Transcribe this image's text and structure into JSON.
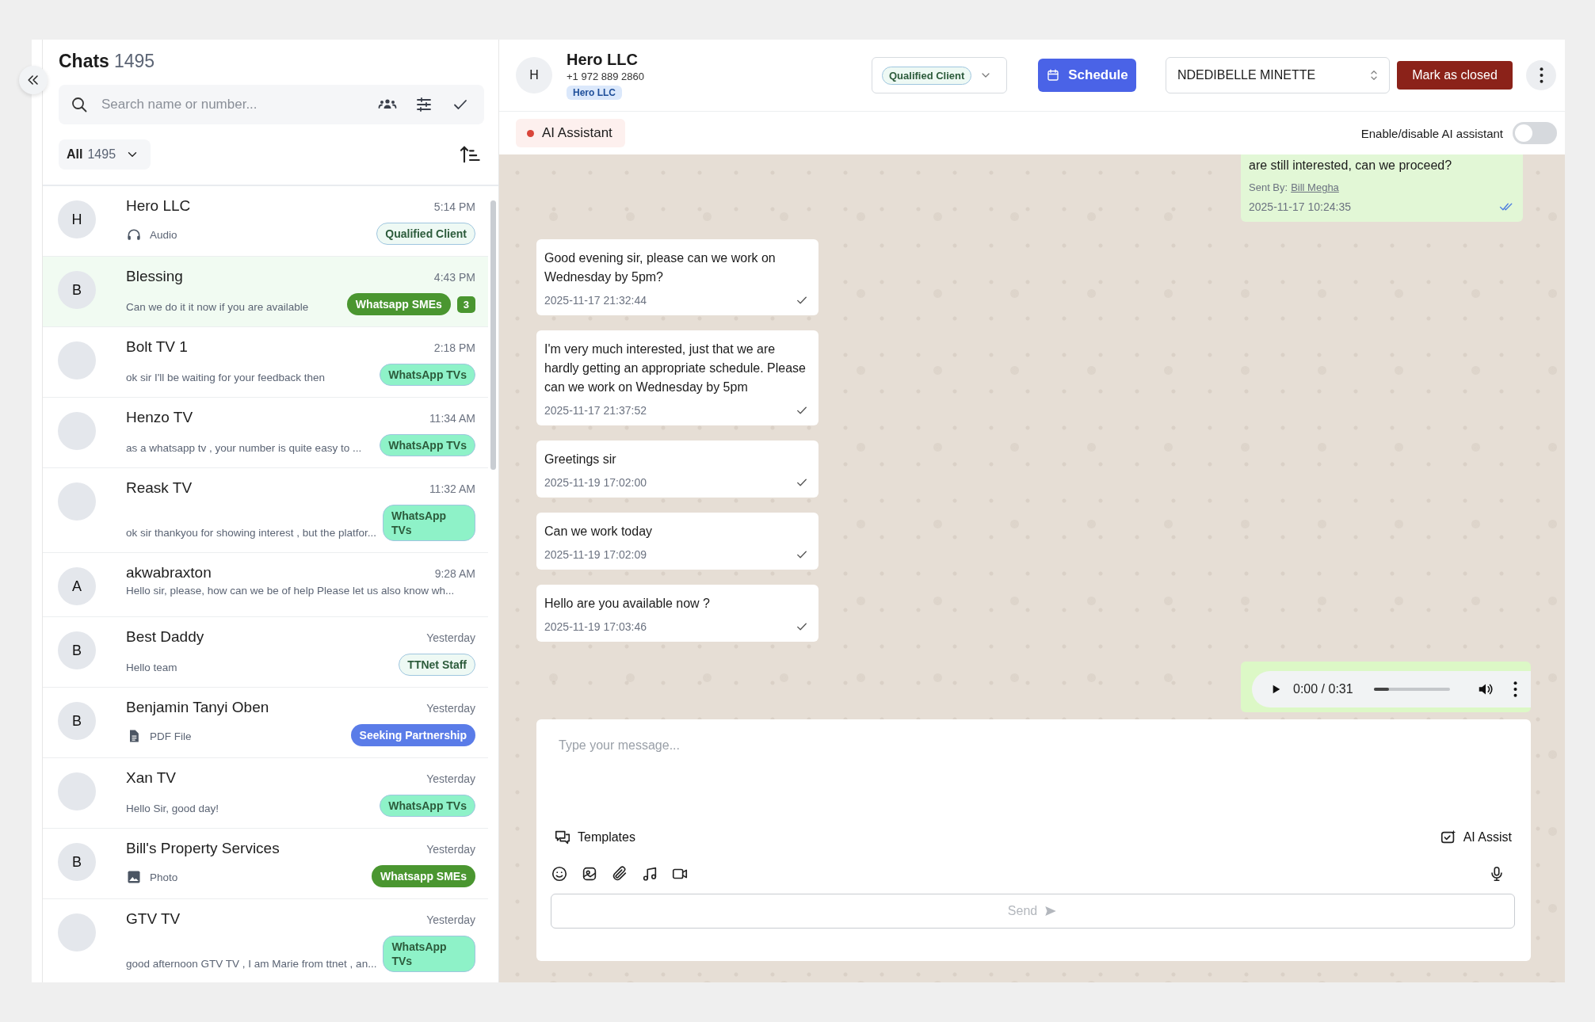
{
  "sidebar": {
    "title": "Chats",
    "count": "1495",
    "search": {
      "placeholder": "Search name or number..."
    },
    "filter": {
      "label": "All",
      "count": "1495"
    },
    "chats": [
      {
        "kind": "audio",
        "initial": "H",
        "name": "Hero LLC",
        "time": "5:14 PM",
        "preview": "Audio",
        "tags": [
          {
            "label": "Qualified Client",
            "color": "#eef9f4"
          }
        ],
        "selected": false
      },
      {
        "kind": "text",
        "initial": "B",
        "name": "Blessing",
        "time": "4:43 PM",
        "preview": "Can we do it it now if you are available",
        "tags": [
          {
            "label": "Whatsapp SMEs",
            "color": "#4a9630"
          }
        ],
        "unread": "3",
        "selected": true
      },
      {
        "kind": "text",
        "name": "Bolt TV 1",
        "time": "2:18 PM",
        "preview": "ok sir I'll be waiting for your feedback then",
        "tags": [
          {
            "label": "WhatsApp TVs",
            "color": "#8ef2c8"
          }
        ],
        "selected": false
      },
      {
        "kind": "text",
        "name": "Henzo TV",
        "time": "11:34 AM",
        "preview": "as a whatsapp tv , your number is quite easy to ...",
        "tags": [
          {
            "label": "WhatsApp TVs",
            "color": "#8ef2c8"
          }
        ],
        "selected": false
      },
      {
        "kind": "text",
        "name": "Reask TV",
        "time": "11:32 AM",
        "preview": "ok sir thankyou for showing interest , but the platfor...",
        "tags": [
          {
            "label": "WhatsApp TVs",
            "color": "#8ef2c8"
          }
        ],
        "selected": false
      },
      {
        "kind": "text",
        "initial": "A",
        "name": "akwabraxton",
        "time": "9:28 AM",
        "preview": "Hello sir, please, how can we be of help Please let us also know wh...",
        "selected": false
      },
      {
        "kind": "text",
        "initial": "B",
        "name": "Best Daddy",
        "time": "Yesterday",
        "preview": "Hello team",
        "tags": [
          {
            "label": "TTNet Staff",
            "color": "#eef9f4"
          }
        ],
        "selected": false
      },
      {
        "kind": "pdf",
        "initial": "B",
        "name": "Benjamin Tanyi Oben",
        "time": "Yesterday",
        "preview": "PDF File",
        "tags": [
          {
            "label": "Seeking Partnership",
            "color": "#5a7ce8"
          }
        ],
        "selected": false
      },
      {
        "kind": "text",
        "name": "Xan TV",
        "time": "Yesterday",
        "preview": "Hello Sir, good day!",
        "tags": [
          {
            "label": "WhatsApp TVs",
            "color": "#8ef2c8"
          }
        ],
        "selected": false
      },
      {
        "kind": "photo",
        "initial": "B",
        "name": "Bill's Property Services",
        "time": "Yesterday",
        "preview": "Photo",
        "tags": [
          {
            "label": "Whatsapp SMEs",
            "color": "#4a9630"
          }
        ],
        "selected": false
      },
      {
        "kind": "text",
        "name": "GTV TV",
        "time": "Yesterday",
        "preview": "good afternoon GTV TV , I am Marie from ttnet , an...",
        "tags": [
          {
            "label": "WhatsApp TVs",
            "color": "#8ef2c8"
          }
        ],
        "selected": false
      }
    ]
  },
  "chat_header": {
    "initial": "H",
    "name": "Hero LLC",
    "phone": "+1 972 889 2860",
    "tag": "Hero LLC",
    "status": "Qualified Client",
    "schedule": "Schedule",
    "agent": "NDEDIBELLE MINETTE",
    "close": "Mark as closed"
  },
  "ai_bar": {
    "label": "AI Assistant",
    "toggle_label": "Enable/disable AI assistant",
    "on": false
  },
  "messages": [
    {
      "kind": "outgoing",
      "text": "are still interested, can we proceed?",
      "sent_by_label": "Sent By:",
      "sent_by": "Bill Megha",
      "time": "2025-11-17 10:24:35",
      "read": true
    },
    {
      "kind": "incoming",
      "text": "Good evening sir, please can we work on Wednesday by 5pm?",
      "time": "2025-11-17 21:32:44",
      "read": false
    },
    {
      "kind": "incoming",
      "text": "I'm very much interested, just that we are hardly getting an appropriate schedule. Please can we work on Wednesday by 5pm",
      "time": "2025-11-17 21:37:52",
      "read": false
    },
    {
      "kind": "incoming",
      "text": "Greetings sir",
      "time": "2025-11-19 17:02:00",
      "read": false
    },
    {
      "kind": "incoming",
      "text": "Can we work today",
      "time": "2025-11-19 17:02:09",
      "read": false
    },
    {
      "kind": "incoming",
      "text": "Hello are you available now ?",
      "time": "2025-11-19 17:03:46",
      "read": false
    },
    {
      "kind": "audio",
      "time_label": "0:00 / 0:31",
      "level": 0.2
    }
  ],
  "composer": {
    "placeholder": "Type your message...",
    "templates": "Templates",
    "ai_assist": "AI Assist",
    "send": "Send",
    "send_disabled": true
  }
}
